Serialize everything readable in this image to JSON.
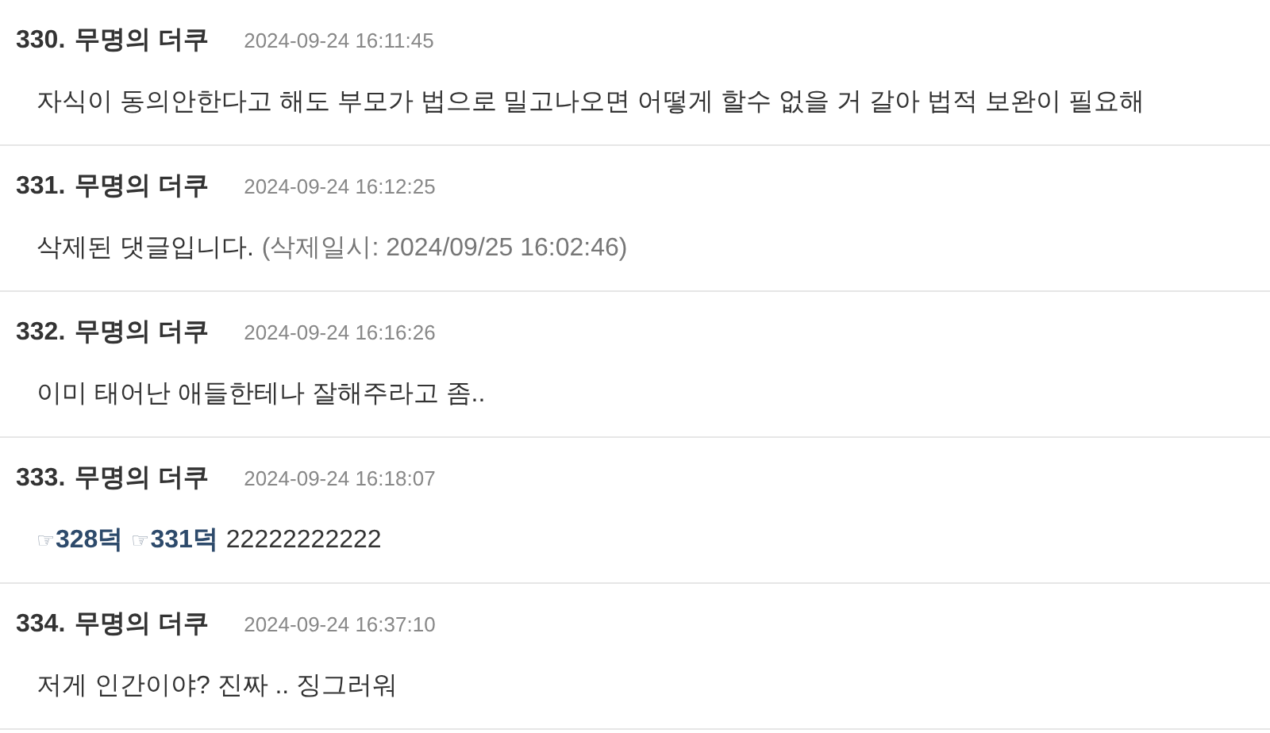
{
  "comments": [
    {
      "number": "330.",
      "author": "무명의 더쿠",
      "time": "2024-09-24 16:11:45",
      "body": [
        {
          "kind": "text",
          "text": "자식이 동의안한다고 해도 부모가 법으로 밀고나오면 어떻게 할수 없을 거 갈아 법적 보완이 필요해"
        }
      ]
    },
    {
      "number": "331.",
      "author": "무명의 더쿠",
      "time": "2024-09-24 16:12:25",
      "body": [
        {
          "kind": "text",
          "text": "삭제된 댓글입니다."
        },
        {
          "kind": "note",
          "text": "(삭제일시: 2024/09/25 16:02:46)"
        }
      ]
    },
    {
      "number": "332.",
      "author": "무명의 더쿠",
      "time": "2024-09-24 16:16:26",
      "body": [
        {
          "kind": "text",
          "text": "이미 태어난 애들한테나 잘해주라고 좀.."
        }
      ]
    },
    {
      "number": "333.",
      "author": "무명의 더쿠",
      "time": "2024-09-24 16:18:07",
      "body": [
        {
          "kind": "link",
          "icon": "☞",
          "text": "328덕"
        },
        {
          "kind": "link",
          "icon": "☞",
          "text": "331덕"
        },
        {
          "kind": "text",
          "text": "22222222222"
        }
      ]
    },
    {
      "number": "334.",
      "author": "무명의 더쿠",
      "time": "2024-09-24 16:37:10",
      "body": [
        {
          "kind": "text",
          "text": "저게 인간이야? 진짜 .. 징그러워"
        }
      ]
    }
  ]
}
